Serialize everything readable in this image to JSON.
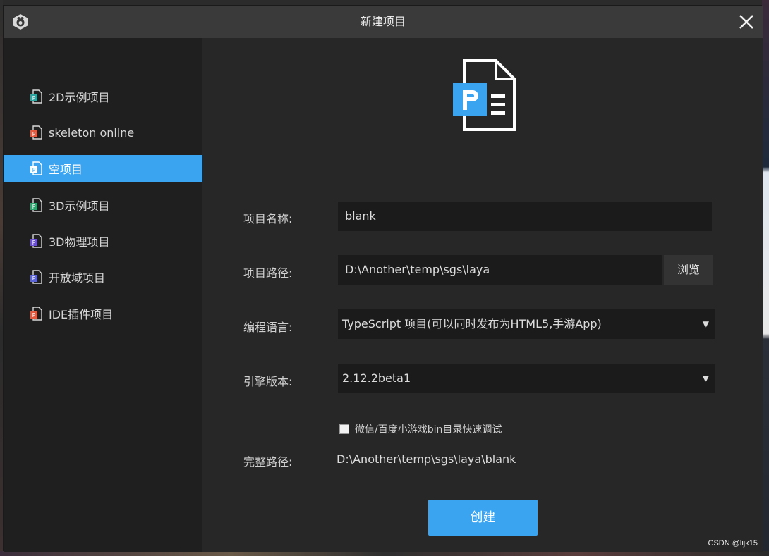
{
  "window": {
    "title": "新建项目"
  },
  "sidebar": {
    "items": [
      {
        "label": "2D示例项目",
        "icon": "project-2d-icon",
        "active": false
      },
      {
        "label": "skeleton online",
        "icon": "project-skeleton-icon",
        "active": false
      },
      {
        "label": "空项目",
        "icon": "project-blank-icon",
        "active": true
      },
      {
        "label": "3D示例项目",
        "icon": "project-3d-icon",
        "active": false
      },
      {
        "label": "3D物理项目",
        "icon": "project-3d-physics-icon",
        "active": false
      },
      {
        "label": "开放域项目",
        "icon": "project-open-domain-icon",
        "active": false
      },
      {
        "label": "IDE插件项目",
        "icon": "project-ide-plugin-icon",
        "active": false
      }
    ]
  },
  "form": {
    "name_label": "项目名称:",
    "name_value": "blank",
    "path_label": "项目路径:",
    "path_value": "D:\\Another\\temp\\sgs\\laya",
    "browse_label": "浏览",
    "language_label": "编程语言:",
    "language_value": "TypeScript 项目(可以同时发布为HTML5,手游App)",
    "engine_label": "引擎版本:",
    "engine_value": "2.12.2beta1",
    "checkbox_label": "微信/百度小游戏bin目录快速调试",
    "checkbox_checked": false,
    "full_path_label": "完整路径:",
    "full_path_value": "D:\\Another\\temp\\sgs\\laya\\blank",
    "create_label": "创建"
  },
  "watermark": "CSDN @lijk15",
  "colors": {
    "accent": "#3ba4f0",
    "titlebar": "#3a3a3a",
    "sidebar": "#1f1f1f",
    "main": "#272727",
    "field": "#1b1b1b"
  }
}
